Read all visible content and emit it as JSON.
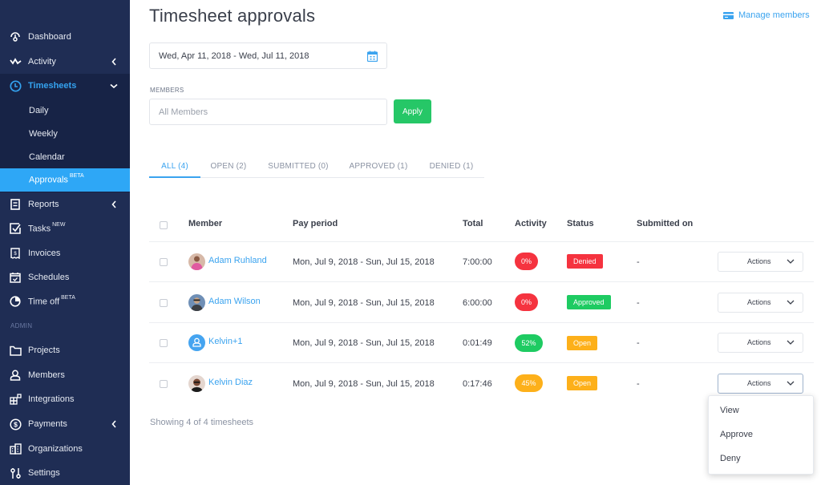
{
  "sidebar": {
    "items": [
      {
        "label": "Dashboard",
        "icon": "dashboard-icon"
      },
      {
        "label": "Activity",
        "icon": "activity-icon",
        "chevron": "left"
      },
      {
        "label": "Timesheets",
        "icon": "clock-icon",
        "chevron": "down",
        "expanded": true
      },
      {
        "label": "Reports",
        "icon": "reports-icon",
        "chevron": "left"
      },
      {
        "label": "Tasks",
        "badge": "NEW",
        "icon": "tasks-icon"
      },
      {
        "label": "Invoices",
        "icon": "invoice-icon"
      },
      {
        "label": "Schedules",
        "icon": "calendar-check-icon"
      },
      {
        "label": "Time off",
        "badge": "BETA",
        "icon": "pie-icon"
      },
      {
        "label": "Projects",
        "icon": "folder-icon"
      },
      {
        "label": "Members",
        "icon": "user-icon"
      },
      {
        "label": "Integrations",
        "icon": "integrations-icon"
      },
      {
        "label": "Payments",
        "icon": "dollar-icon",
        "chevron": "left"
      },
      {
        "label": "Organizations",
        "icon": "building-icon"
      },
      {
        "label": "Settings",
        "icon": "sliders-icon"
      }
    ],
    "timesheet_sub": [
      {
        "label": "Daily"
      },
      {
        "label": "Weekly"
      },
      {
        "label": "Calendar"
      },
      {
        "label": "Approvals",
        "badge": "BETA",
        "selected": true
      }
    ],
    "admin_label": "ADMIN"
  },
  "header": {
    "title": "Timesheet approvals",
    "manage_members": "Manage members"
  },
  "filters": {
    "date_range": "Wed, Apr 11, 2018 - Wed, Jul 11, 2018",
    "members_label": "MEMBERS",
    "members_placeholder": "All Members",
    "members_value": "",
    "apply_label": "Apply"
  },
  "tabs": [
    {
      "label": "ALL (4)",
      "active": true
    },
    {
      "label": "OPEN (2)"
    },
    {
      "label": "SUBMITTED (0)"
    },
    {
      "label": "APPROVED (1)"
    },
    {
      "label": "DENIED (1)"
    }
  ],
  "table": {
    "headers": {
      "member": "Member",
      "pay_period": "Pay period",
      "total": "Total",
      "activity": "Activity",
      "status": "Status",
      "submitted_on": "Submitted on"
    },
    "rows": [
      {
        "member": "Adam Ruhland",
        "pay_period": "Mon, Jul 9, 2018 - Sun, Jul 15, 2018",
        "total": "7:00:00",
        "activity": "0%",
        "activity_color": "#f5333f",
        "status": "Denied",
        "status_color": "#f5333f",
        "submitted_on": "-",
        "actions": "Actions"
      },
      {
        "member": "Adam Wilson",
        "pay_period": "Mon, Jul 9, 2018 - Sun, Jul 15, 2018",
        "total": "6:00:00",
        "activity": "0%",
        "activity_color": "#f5333f",
        "status": "Approved",
        "status_color": "#1ecb62",
        "submitted_on": "-",
        "actions": "Actions"
      },
      {
        "member": "Kelvin+1",
        "pay_period": "Mon, Jul 9, 2018 - Sun, Jul 15, 2018",
        "total": "0:01:49",
        "activity": "52%",
        "activity_color": "#1ecb62",
        "status": "Open",
        "status_color": "#fdb01a",
        "submitted_on": "-",
        "actions": "Actions"
      },
      {
        "member": "Kelvin Diaz",
        "pay_period": "Mon, Jul 9, 2018 - Sun, Jul 15, 2018",
        "total": "0:17:46",
        "activity": "45%",
        "activity_color": "#fdb01a",
        "status": "Open",
        "status_color": "#fdb01a",
        "submitted_on": "-",
        "actions": "Actions"
      }
    ],
    "footer": "Showing 4 of 4 timesheets"
  },
  "actions_menu": {
    "items": [
      "View",
      "Approve",
      "Deny"
    ]
  },
  "colors": {
    "sidebar_bg": "#1f2d54",
    "accent": "#3aa3ef",
    "selected_nav": "#2ea7f6",
    "apply_green": "#26c767"
  }
}
